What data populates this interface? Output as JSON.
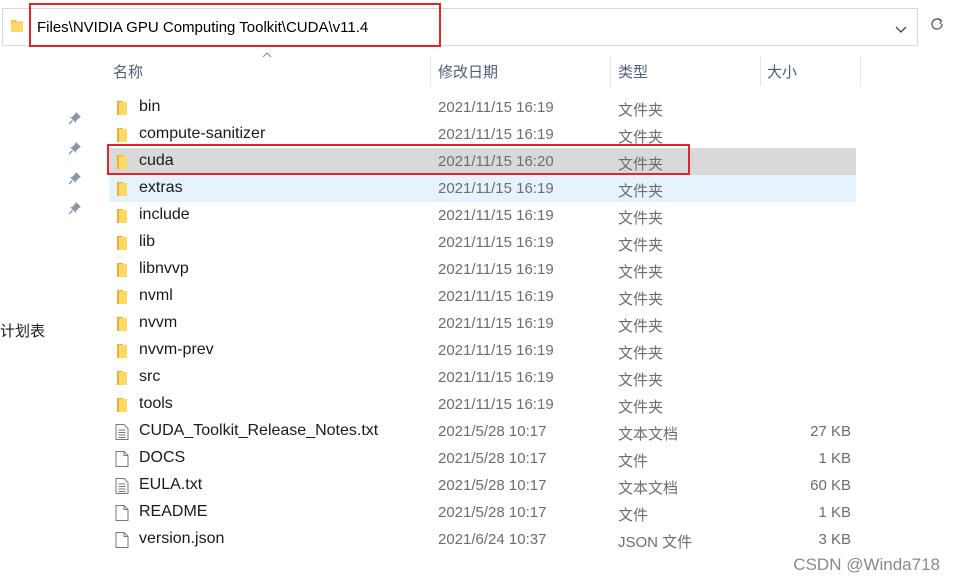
{
  "address_bar": {
    "path": "Files\\NVIDIA GPU Computing Toolkit\\CUDA\\v11.4"
  },
  "nav": {
    "partial_label": "计划表"
  },
  "columns": {
    "name": "名称",
    "modified": "修改日期",
    "type": "类型",
    "size": "大小"
  },
  "files": [
    {
      "name": "bin",
      "modified": "2021/11/15 16:19",
      "type": "文件夹",
      "size": "",
      "icon": "folder-icon"
    },
    {
      "name": "compute-sanitizer",
      "modified": "2021/11/15 16:19",
      "type": "文件夹",
      "size": "",
      "icon": "folder-icon"
    },
    {
      "name": "cuda",
      "modified": "2021/11/15 16:20",
      "type": "文件夹",
      "size": "",
      "icon": "folder-icon"
    },
    {
      "name": "extras",
      "modified": "2021/11/15 16:19",
      "type": "文件夹",
      "size": "",
      "icon": "folder-icon"
    },
    {
      "name": "include",
      "modified": "2021/11/15 16:19",
      "type": "文件夹",
      "size": "",
      "icon": "folder-icon"
    },
    {
      "name": "lib",
      "modified": "2021/11/15 16:19",
      "type": "文件夹",
      "size": "",
      "icon": "folder-icon"
    },
    {
      "name": "libnvvp",
      "modified": "2021/11/15 16:19",
      "type": "文件夹",
      "size": "",
      "icon": "folder-icon"
    },
    {
      "name": "nvml",
      "modified": "2021/11/15 16:19",
      "type": "文件夹",
      "size": "",
      "icon": "folder-icon"
    },
    {
      "name": "nvvm",
      "modified": "2021/11/15 16:19",
      "type": "文件夹",
      "size": "",
      "icon": "folder-icon"
    },
    {
      "name": "nvvm-prev",
      "modified": "2021/11/15 16:19",
      "type": "文件夹",
      "size": "",
      "icon": "folder-icon"
    },
    {
      "name": "src",
      "modified": "2021/11/15 16:19",
      "type": "文件夹",
      "size": "",
      "icon": "folder-icon"
    },
    {
      "name": "tools",
      "modified": "2021/11/15 16:19",
      "type": "文件夹",
      "size": "",
      "icon": "folder-icon"
    },
    {
      "name": "CUDA_Toolkit_Release_Notes.txt",
      "modified": "2021/5/28 10:17",
      "type": "文本文档",
      "size": "27 KB",
      "icon": "text-file-icon"
    },
    {
      "name": "DOCS",
      "modified": "2021/5/28 10:17",
      "type": "文件",
      "size": "1 KB",
      "icon": "file-icon"
    },
    {
      "name": "EULA.txt",
      "modified": "2021/5/28 10:17",
      "type": "文本文档",
      "size": "60 KB",
      "icon": "text-file-icon"
    },
    {
      "name": "README",
      "modified": "2021/5/28 10:17",
      "type": "文件",
      "size": "1 KB",
      "icon": "file-icon"
    },
    {
      "name": "version.json",
      "modified": "2021/6/24 10:37",
      "type": "JSON 文件",
      "size": "3 KB",
      "icon": "file-icon"
    }
  ],
  "watermark": "CSDN @Winda718",
  "colors": {
    "highlight_red": "#e0262a",
    "selected_row": "#d9d9d9",
    "hover_row": "#e5f3ff",
    "header_text": "#4c607a",
    "folder_yellow": "#f7c948"
  }
}
